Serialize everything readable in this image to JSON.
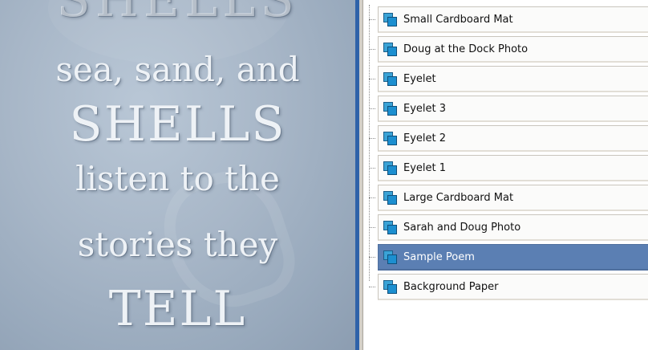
{
  "canvas": {
    "poem_lines": [
      "SHELLS",
      "sea, sand, and",
      "SHELLS",
      "listen to the",
      "stories they",
      "TELL"
    ]
  },
  "layers": [
    {
      "label": "Small Cardboard Mat",
      "selected": false,
      "icon": "layer-icon"
    },
    {
      "label": "Doug at the Dock Photo",
      "selected": false,
      "icon": "layer-icon"
    },
    {
      "label": "Eyelet",
      "selected": false,
      "icon": "layer-icon"
    },
    {
      "label": "Eyelet 3",
      "selected": false,
      "icon": "layer-icon"
    },
    {
      "label": "Eyelet 2",
      "selected": false,
      "icon": "layer-icon"
    },
    {
      "label": "Eyelet 1",
      "selected": false,
      "icon": "layer-icon"
    },
    {
      "label": "Large Cardboard Mat",
      "selected": false,
      "icon": "layer-icon"
    },
    {
      "label": "Sarah and Doug Photo",
      "selected": false,
      "icon": "layer-icon"
    },
    {
      "label": "Sample Poem",
      "selected": true,
      "icon": "layer-icon"
    },
    {
      "label": "Background Paper",
      "selected": false,
      "icon": "layer-icon"
    }
  ],
  "colors": {
    "accent": "#2f62a9",
    "selection": "#5b7fb3",
    "layer_icon": "#1c8fd0"
  }
}
